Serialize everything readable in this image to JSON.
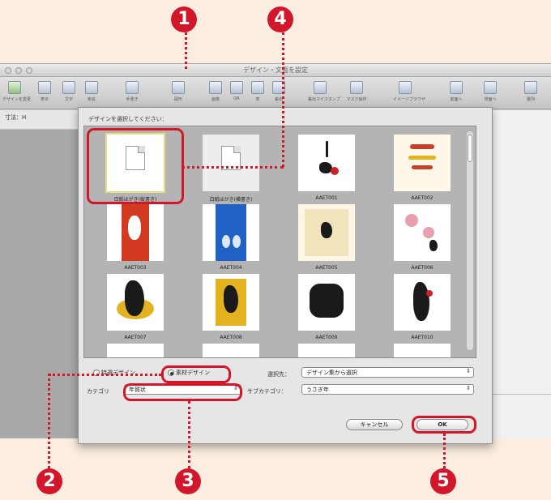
{
  "window": {
    "title": "デザイン・文面を設定"
  },
  "toolbar": {
    "items": [
      {
        "label": "デザインを変更",
        "icon": "change-design-icon"
      },
      {
        "label": "表示",
        "icon": "view-icon"
      },
      {
        "label": "文字",
        "icon": "text-icon"
      },
      {
        "label": "宛名",
        "icon": "address-icon"
      },
      {
        "label": "手書き",
        "icon": "handwriting-icon"
      },
      {
        "label": "図形",
        "icon": "shape-icon"
      },
      {
        "label": "画像",
        "icon": "image-icon"
      },
      {
        "label": "QR",
        "icon": "qr-icon"
      },
      {
        "label": "表",
        "icon": "table-icon"
      },
      {
        "label": "差出",
        "icon": "sender-icon"
      },
      {
        "label": "差出マイスタンプ",
        "icon": "stamp-icon"
      },
      {
        "label": "マスク操作",
        "icon": "mask-icon"
      },
      {
        "label": "イメージブラウザ",
        "icon": "image-browser-icon"
      },
      {
        "label": "前面へ",
        "icon": "front-icon"
      },
      {
        "label": "背面へ",
        "icon": "back-icon"
      },
      {
        "label": "整列",
        "icon": "align-icon"
      }
    ]
  },
  "sidebar": {
    "pages_label": "寸法：H"
  },
  "dialog": {
    "prompt": "デザインを選択してください：",
    "tiles": [
      {
        "caption": "白紙はがき(縦書き)",
        "selected": true
      },
      {
        "caption": "白紙はがき(横書き)",
        "selected": false
      },
      {
        "caption": "AAET001",
        "selected": false
      },
      {
        "caption": "AAET002",
        "selected": false
      },
      {
        "caption": "AAET003",
        "selected": false
      },
      {
        "caption": "AAET004",
        "selected": false
      },
      {
        "caption": "AAET005",
        "selected": false
      },
      {
        "caption": "AAET006",
        "selected": false
      },
      {
        "caption": "AAET007",
        "selected": false
      },
      {
        "caption": "AAET008",
        "selected": false
      },
      {
        "caption": "AAET009",
        "selected": false
      },
      {
        "caption": "AAET010",
        "selected": false
      }
    ],
    "radio_options": [
      {
        "label": "特選デザイン",
        "checked": false
      },
      {
        "label": "素材デザイン",
        "checked": true
      }
    ],
    "source_label": "選択先：",
    "source_value": "デザイン集から選択",
    "category_label": "カテゴリ",
    "category_value": "年賀状",
    "subcategory_label": "サブカテゴリ：",
    "subcategory_value": "うさぎ年",
    "cancel_label": "キャンセル",
    "ok_label": "OK"
  },
  "callouts": [
    "1",
    "2",
    "3",
    "4",
    "5"
  ],
  "colors": {
    "callout_red": "#d2172a",
    "background": "#fbeee0"
  }
}
